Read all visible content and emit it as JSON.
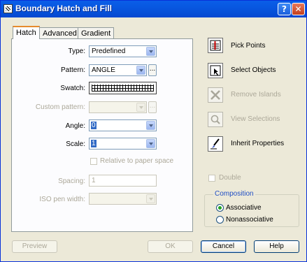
{
  "window": {
    "title": "Boundary Hatch and Fill",
    "help_button": "?",
    "close_button": "✕"
  },
  "tabs": [
    {
      "label": "Hatch",
      "active": true
    },
    {
      "label": "Advanced",
      "active": false
    },
    {
      "label": "Gradient",
      "active": false
    }
  ],
  "hatch": {
    "type_label": "Type:",
    "type_value": "Predefined",
    "pattern_label": "Pattern:",
    "pattern_value": "ANGLE",
    "pattern_browse": "...",
    "swatch_label": "Swatch:",
    "custom_pattern_label": "Custom pattern:",
    "custom_pattern_browse": "...",
    "angle_label": "Angle:",
    "angle_value": "0",
    "scale_label": "Scale:",
    "scale_value": "1",
    "relative_label": "Relative to paper space",
    "relative_checked": false,
    "spacing_label": "Spacing:",
    "spacing_value": "1",
    "iso_label": "ISO pen width:"
  },
  "actions": {
    "pick_points": "Pick Points",
    "select_objects": "Select Objects",
    "remove_islands": "Remove Islands",
    "view_selections": "View Selections",
    "inherit_properties": "Inherit Properties"
  },
  "double": {
    "label": "Double",
    "checked": false
  },
  "composition": {
    "title": "Composition",
    "options": [
      {
        "label": "Associative",
        "selected": true
      },
      {
        "label": "Nonassociative",
        "selected": false
      }
    ]
  },
  "buttons": {
    "preview": "Preview",
    "ok": "OK",
    "cancel": "Cancel",
    "help": "Help"
  },
  "colors": {
    "title_bar": "#0a5ee8",
    "dialog_face": "#ece9d8",
    "selection": "#316ac5",
    "group_title": "#1f4ec4",
    "tab_highlight": "#e68b2c"
  }
}
